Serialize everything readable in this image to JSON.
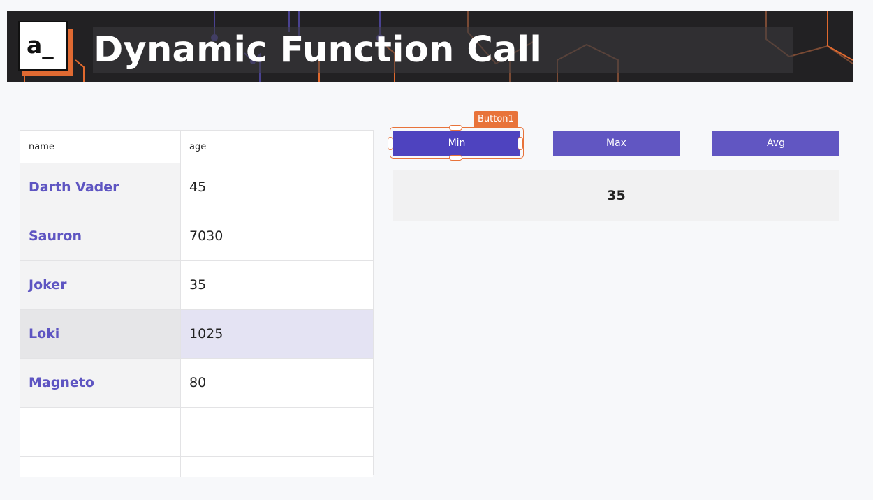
{
  "header": {
    "logo_text": "a_",
    "title": "Dynamic Function Call"
  },
  "table": {
    "columns": [
      "name",
      "age"
    ],
    "rows": [
      {
        "name": "Darth Vader",
        "age": "45"
      },
      {
        "name": "Sauron",
        "age": "7030"
      },
      {
        "name": "Joker",
        "age": "35"
      },
      {
        "name": "Loki",
        "age": "1025"
      },
      {
        "name": "Magneto",
        "age": "80"
      }
    ],
    "selected_row_index": 3
  },
  "buttons": {
    "min_label": "Min",
    "max_label": "Max",
    "avg_label": "Avg"
  },
  "editor": {
    "selected_widget_label": "Button1"
  },
  "result": {
    "value": "35"
  },
  "colors": {
    "primary": "#6156c2",
    "primary_active": "#4e43bf",
    "selection_accent": "#e8733a",
    "banner_bg": "#222123",
    "link_text": "#5e55c2",
    "selected_row_bg": "#e4e3f3"
  }
}
